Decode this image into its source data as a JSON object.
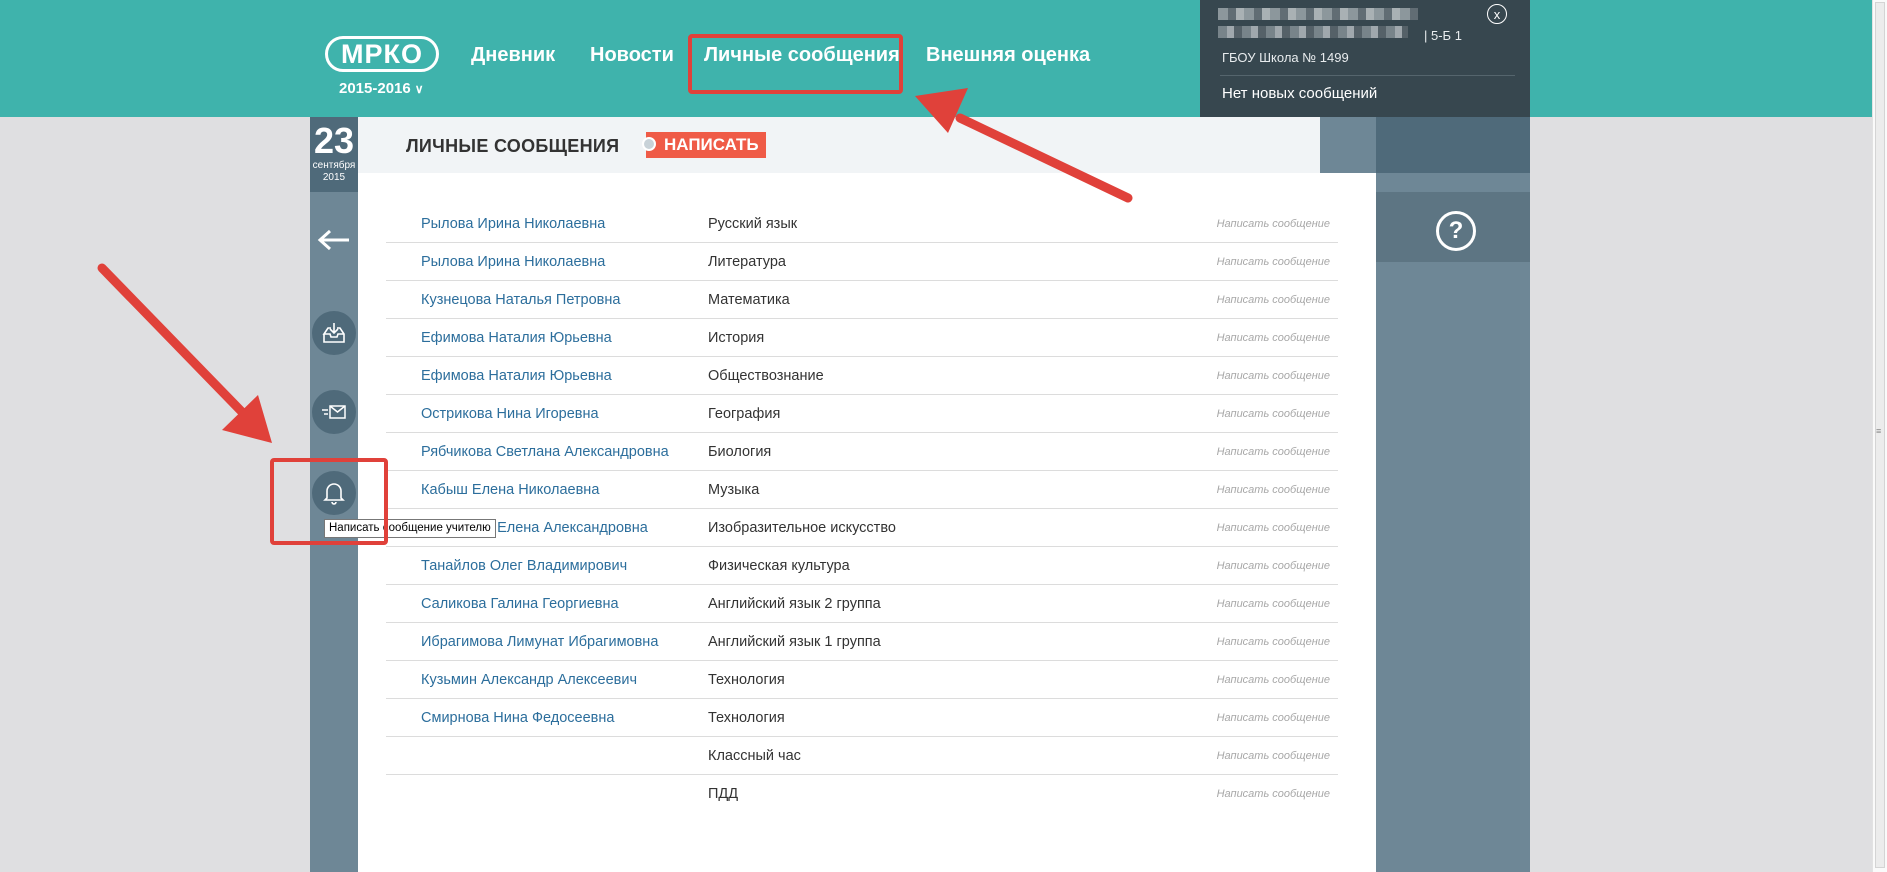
{
  "header": {
    "logo": "МРКО",
    "year": "2015-2016",
    "nav": [
      "Дневник",
      "Новости",
      "Личные сообщения",
      "Внешняя оценка"
    ]
  },
  "user_panel": {
    "class": "| 5-Б 1",
    "school": "ГБОУ Школа № 1499",
    "messages": "Нет новых сообщений",
    "close": "x"
  },
  "date": {
    "day": "23",
    "month": "сентября",
    "year": "2015"
  },
  "page": {
    "title": "ЛИЧНЫЕ СООБЩЕНИЯ",
    "write_button": "НАПИСАТЬ"
  },
  "tooltip": "Написать сообщение учителю",
  "help": "?",
  "action_label": "Написать сообщение",
  "teachers": [
    {
      "teacher": "Рылова Ирина Николаевна",
      "subject": "Русский язык"
    },
    {
      "teacher": "Рылова Ирина Николаевна",
      "subject": "Литература"
    },
    {
      "teacher": "Кузнецова Наталья Петровна",
      "subject": "Математика"
    },
    {
      "teacher": "Ефимова Наталия Юрьевна",
      "subject": "История"
    },
    {
      "teacher": "Ефимова Наталия Юрьевна",
      "subject": "Обществознание"
    },
    {
      "teacher": "Острикова Нина Игоревна",
      "subject": "География"
    },
    {
      "teacher": "Рябчикова Светлана Александровна",
      "subject": "Биология"
    },
    {
      "teacher": "Кабыш Елена Николаевна",
      "subject": "Музыка"
    },
    {
      "teacher": "Черникова Елена Александровна",
      "subject": "Изобразительное искусство"
    },
    {
      "teacher": "Танайлов Олег Владимирович",
      "subject": "Физическая культура"
    },
    {
      "teacher": "Саликова Галина Георгиевна",
      "subject": "Английский язык 2 группа"
    },
    {
      "teacher": "Ибрагимова Лимунат Ибрагимовна",
      "subject": "Английский язык 1 группа"
    },
    {
      "teacher": "Кузьмин Александр Алексеевич",
      "subject": "Технология"
    },
    {
      "teacher": "Смирнова Нина Федосеевна",
      "subject": "Технология"
    },
    {
      "teacher": "",
      "subject": "Классный час"
    },
    {
      "teacher": "",
      "subject": "ПДД"
    }
  ],
  "colors": {
    "header": "#3fb3ac",
    "sidebar": "#6e8796",
    "accent": "#ef5b47",
    "annotation": "#e0413a",
    "link": "#2c6e9c"
  },
  "icons": {
    "inbox": "inbox-icon",
    "sent": "sent-mail-icon",
    "notifications": "bell-icon",
    "back": "back-arrow-icon",
    "apps": "apps-grid-icon",
    "help": "help-icon"
  }
}
